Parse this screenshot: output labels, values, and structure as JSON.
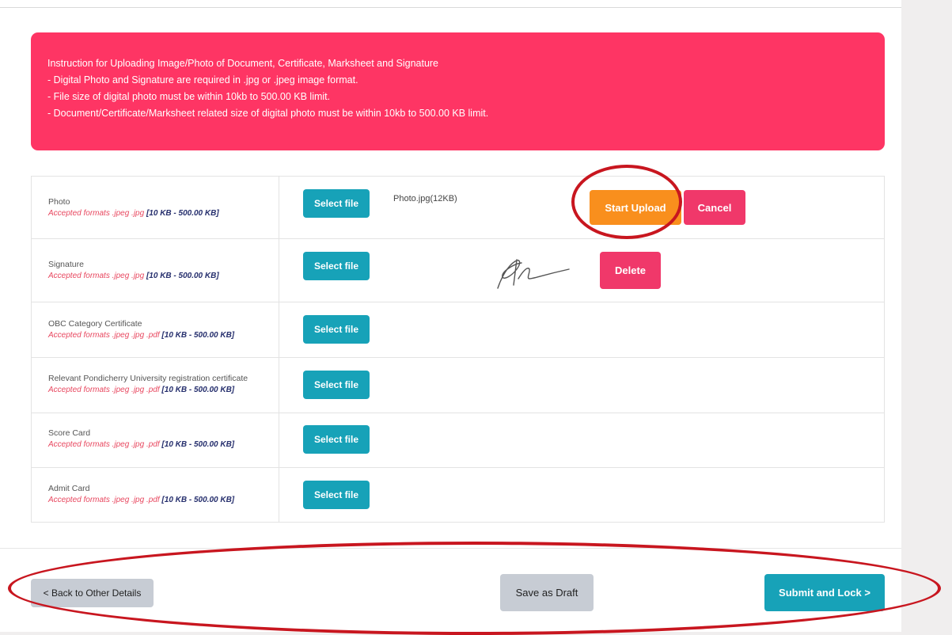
{
  "instructions": {
    "title": "Instruction for Uploading Image/Photo of Document, Certificate, Marksheet and Signature",
    "lines": [
      "- Digital Photo and Signature are required in .jpg or .jpeg image format.",
      "- File size of digital photo must be within 10kb to 500.00 KB limit.",
      "- Document/Certificate/Marksheet related size of digital photo must be within 10kb to 500.00 KB limit."
    ]
  },
  "select_label": "Select file",
  "documents": [
    {
      "name": "Photo",
      "formats": "Accepted formats .jpeg .jpg",
      "size_range": "[10 KB - 500.00 KB]",
      "file_name": "Photo.jpg(12KB)",
      "start_upload_label": "Start Upload",
      "cancel_label": "Cancel"
    },
    {
      "name": "Signature",
      "formats": "Accepted formats .jpeg .jpg",
      "size_range": "[10 KB - 500.00 KB]",
      "delete_label": "Delete"
    },
    {
      "name": "OBC Category Certificate",
      "formats": "Accepted formats .jpeg .jpg .pdf",
      "size_range": "[10 KB - 500.00 KB]"
    },
    {
      "name": "Relevant Pondicherry University registration certificate",
      "formats": "Accepted formats .jpeg .jpg .pdf",
      "size_range": "[10 KB - 500.00 KB]"
    },
    {
      "name": "Score Card",
      "formats": "Accepted formats .jpeg .jpg .pdf",
      "size_range": "[10 KB - 500.00 KB]"
    },
    {
      "name": "Admit Card",
      "formats": "Accepted formats .jpeg .jpg .pdf",
      "size_range": "[10 KB - 500.00 KB]"
    }
  ],
  "footer": {
    "back_label": "< Back to Other Details",
    "draft_label": "Save as Draft",
    "submit_label": "Submit and Lock >"
  },
  "colors": {
    "alert": "#fe3564",
    "primary": "#17a2b8",
    "start_upload": "#f98f1d",
    "danger": "#f0386a",
    "secondary": "#c7ccd4",
    "highlight_annotation": "#c8161f"
  }
}
